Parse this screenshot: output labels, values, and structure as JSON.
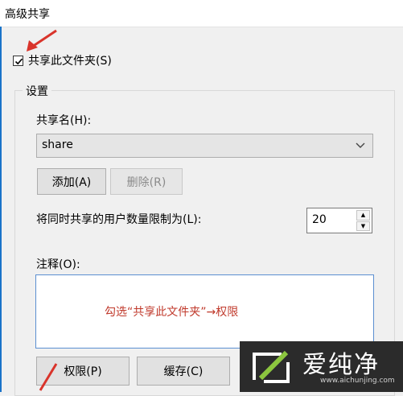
{
  "window": {
    "title": "高级共享"
  },
  "share_checkbox": {
    "label": "共享此文件夹(S)",
    "checked": true
  },
  "settings": {
    "legend": "设置",
    "share_name_label": "共享名(H):",
    "share_name_value": "share",
    "add_button": "添加(A)",
    "remove_button": "删除(R)",
    "user_limit_label": "将同时共享的用户数量限制为(L):",
    "user_limit_value": "20",
    "comments_label": "注释(O):",
    "comments_value": "",
    "permissions_button": "权限(P)",
    "caching_button": "缓存(C)"
  },
  "annotation": {
    "text": "勾选“共享此文件夹”→权限",
    "color": "#c0392b"
  },
  "watermark": {
    "name": "爱纯净",
    "url": "www.aichunjing.com"
  },
  "colors": {
    "accent": "#1a73c9",
    "arrow": "#d9342b"
  }
}
